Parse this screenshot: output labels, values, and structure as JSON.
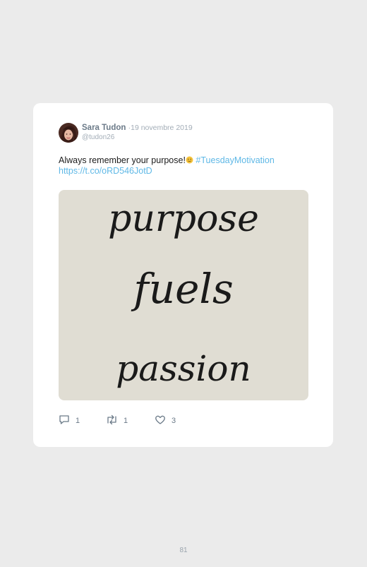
{
  "tweet": {
    "author_name": "Sara Tudon",
    "separator": "·",
    "date": "19 novembre 2019",
    "handle": "@tudon26",
    "text": "Always remember your purpose!",
    "emoji": "slightly-smiling-face-emoji",
    "hashtag": "#TuesdayMotivation",
    "link": "https://t.co/oRD546JotD",
    "image_words": [
      "purpose",
      "fuels",
      "passion"
    ],
    "reply_count": "1",
    "retweet_count": "1",
    "like_count": "3"
  },
  "page": {
    "number": "81"
  },
  "colors": {
    "background": "#ebebeb",
    "card": "#ffffff",
    "link": "#5fb8e6",
    "muted": "#a3adb7",
    "image_bg": "#e0ddd3"
  }
}
